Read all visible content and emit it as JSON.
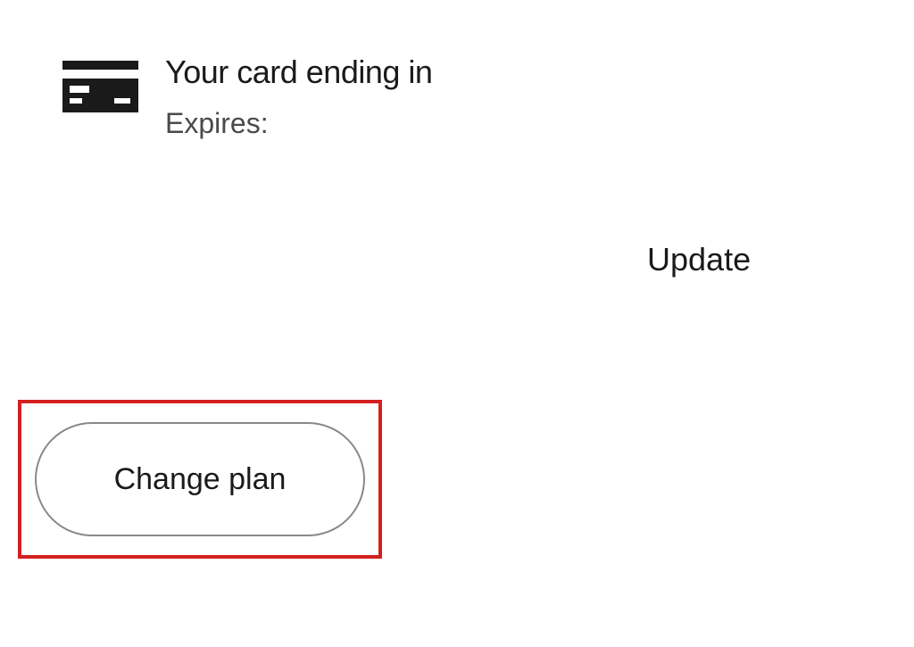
{
  "payment": {
    "card_ending_label": "Your card ending in",
    "expires_label": "Expires:"
  },
  "actions": {
    "update_label": "Update",
    "change_plan_label": "Change plan"
  }
}
